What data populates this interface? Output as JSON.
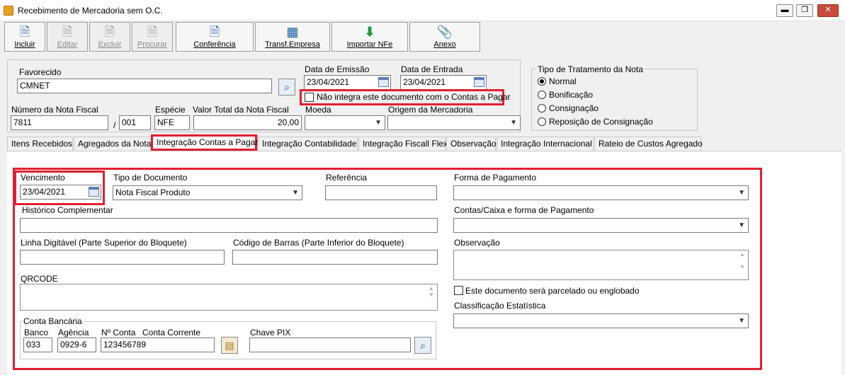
{
  "window": {
    "title": "Recebimento de Mercadoria sem O.C.",
    "min": "▬",
    "restore": "❐",
    "close": "✕"
  },
  "toolbar": {
    "incluir": "Incluir",
    "editar": "Editar",
    "excluir": "Excluir",
    "procurar": "Procurar",
    "conferencia": "Conferência",
    "transf": "Transf.Empresa",
    "importar": "Importar NFe",
    "anexo": "Anexo"
  },
  "header": {
    "favorecido_label": "Favorecido",
    "favorecido_value": "CMNET",
    "data_emissao_label": "Data de Emissão",
    "data_emissao_value": "23/04/2021",
    "data_entrada_label": "Data de Entrada",
    "data_entrada_value": "23/04/2021",
    "nao_integra_label": "Não integra este documento com o Contas a Pagar",
    "numero_nf_label": "Número da Nota Fiscal",
    "numero_nf_value": "7811",
    "slash": "/",
    "serie_value": "001",
    "especie_label": "Espécie",
    "especie_value": "NFE",
    "valor_total_label": "Valor Total da Nota Fiscal",
    "valor_total_value": "20,00",
    "moeda_label": "Moeda",
    "moeda_value": "",
    "origem_label": "Origem da Mercadoria",
    "origem_value": ""
  },
  "tratamento": {
    "label": "Tipo de Tratamento da Nota",
    "options": [
      "Normal",
      "Bonificação",
      "Consignação",
      "Reposição de Consignação"
    ],
    "selected": "Normal"
  },
  "tabs": [
    "Itens Recebidos",
    "Agregados da Nota",
    "Integração Contas a Pagar",
    "Integração Contabilidade",
    "Integração Fiscall Flex",
    "Observação",
    "Integração Internacional",
    "Rateio de Custos Agregado"
  ],
  "active_tab": "Integração Contas a Pagar",
  "form": {
    "vencimento_label": "Vencimento",
    "vencimento_value": "23/04/2021",
    "tipo_doc_label": "Tipo de Documento",
    "tipo_doc_value": "Nota Fiscal Produto",
    "referencia_label": "Referência",
    "referencia_value": "",
    "forma_pag_label": "Forma de Pagamento",
    "forma_pag_value": "",
    "historico_label": "Histórico Complementar",
    "historico_value": "",
    "contas_caixa_label": "Contas/Caixa e forma de Pagamento",
    "contas_caixa_value": "",
    "linha_digitavel_label": "Linha Digitável (Parte Superior do Bloquete)",
    "linha_digitavel_value": "",
    "codigo_barras_label": "Código de Barras (Parte Inferior do Bloquete)",
    "codigo_barras_value": "",
    "observacao_label": "Observação",
    "qrcode_label": "QRCODE",
    "parcelado_label": "Este documento será parcelado ou englobado",
    "classificacao_label": "Classificação Estatística",
    "classificacao_value": "",
    "conta_bancaria_label": "Conta Bancária",
    "banco_label": "Banco",
    "banco_value": "033",
    "agencia_label": "Agência",
    "agencia_value": "0929-6",
    "nconta_label": "Nº Conta",
    "conta_corrente_label": "Conta Corrente",
    "conta_value": "123456789",
    "chave_pix_label": "Chave PIX",
    "chave_pix_value": ""
  },
  "colors": {
    "highlight": "#e02030",
    "accent": "#1a4f9c"
  }
}
